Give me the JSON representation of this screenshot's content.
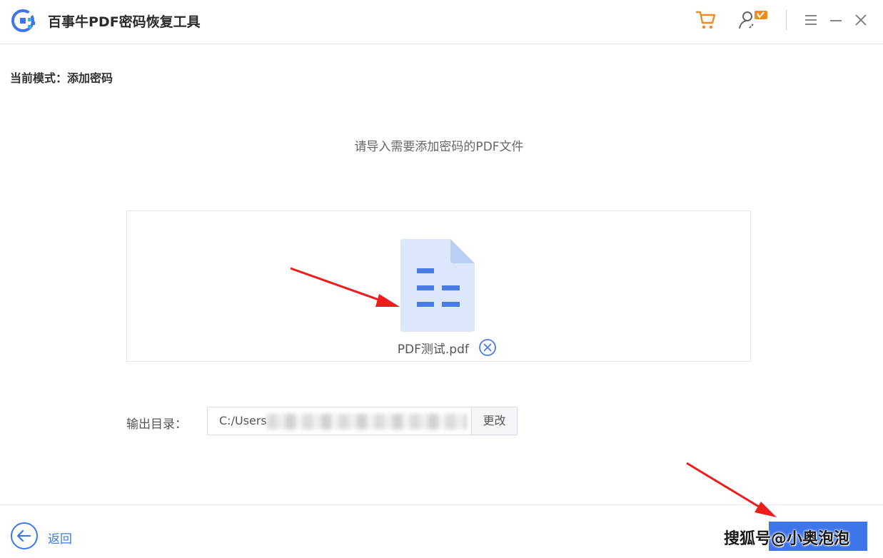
{
  "window": {
    "title": "百事牛PDF密码恢复工具",
    "icons": [
      "app-logo",
      "cart-icon",
      "user-vip-icon",
      "menu-icon",
      "minimize-icon",
      "close-icon"
    ]
  },
  "mode": {
    "label": "当前模式：",
    "value": "添加密码"
  },
  "main": {
    "prompt": "请导入需要添加密码的PDF文件",
    "file": {
      "name": "PDF测试.pdf",
      "icon": "pdf-file-icon",
      "remove_icon": "remove-circle-icon"
    },
    "output": {
      "label": "输出目录：",
      "path_visible": "C:/Users",
      "change_label": "更改"
    }
  },
  "footer": {
    "back_label": "返回",
    "watermark": "搜狐号@小奥泡泡"
  },
  "colors": {
    "accent": "#3e75ea",
    "file_icon_bg": "#dce7fb",
    "file_icon_lines": "#4a7be0",
    "cart": "#f08a24",
    "annotation_arrow": "#ee1c1c"
  }
}
